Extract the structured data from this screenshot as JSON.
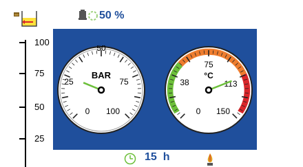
{
  "header": {
    "fill_percent": "50 %",
    "tank_icon": "tank-level-icon",
    "pump_icon": "pump-speed-icon"
  },
  "level_scale": {
    "labels": [
      "100",
      "75",
      "50",
      "25"
    ]
  },
  "pressure_gauge": {
    "unit": "BAR",
    "ticks": [
      "0",
      "25",
      "50",
      "75",
      "100"
    ],
    "value": 25
  },
  "temperature_gauge": {
    "unit": "°C",
    "ticks": [
      "0",
      "38",
      "75",
      "113",
      "150"
    ],
    "value": 113
  },
  "footer": {
    "hours": "15  h",
    "clock_icon": "clock-icon",
    "burner_icon": "flame-icon"
  },
  "colors": {
    "accent_blue": "#1f4f9c",
    "gauge_green": "#6cbf3a",
    "gauge_orange": "#ee7d2f",
    "gauge_red": "#d9262a",
    "needle": "#6cbf3a"
  }
}
